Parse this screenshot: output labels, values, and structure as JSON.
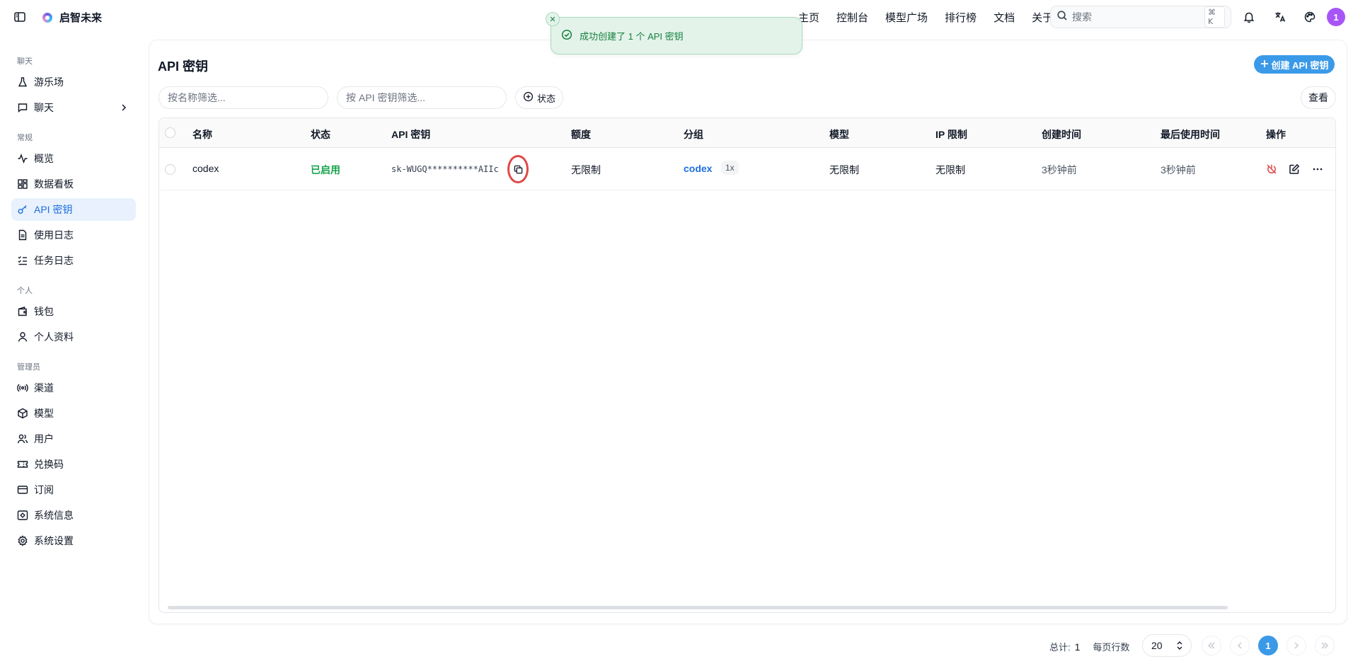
{
  "brand": {
    "name": "启智未来"
  },
  "nav": {
    "items": [
      "主页",
      "控制台",
      "模型广场",
      "排行榜",
      "文档",
      "关于"
    ]
  },
  "search": {
    "placeholder": "搜索",
    "shortcut": "⌘ K"
  },
  "user": {
    "avatar_text": "1",
    "avatar_color": "#a855f7"
  },
  "sidebar": {
    "sections": {
      "chat": "聊天",
      "general": "常规",
      "personal": "个人",
      "admin": "管理员"
    },
    "items": {
      "playground": "游乐场",
      "chat": "聊天",
      "overview": "概览",
      "dashboard": "数据看板",
      "api_keys": "API 密钥",
      "usage_logs": "使用日志",
      "task_logs": "任务日志",
      "wallet": "钱包",
      "profile": "个人资料",
      "channels": "渠道",
      "models": "模型",
      "users": "用户",
      "redeem_codes": "兑换码",
      "subscriptions": "订阅",
      "system_info": "系统信息",
      "system_settings": "系统设置"
    },
    "active": "api_keys"
  },
  "page": {
    "title": "API 密钥",
    "create_button": "创建 API 密钥",
    "filter_name_placeholder": "按名称筛选...",
    "filter_key_placeholder": "按 API 密钥筛选...",
    "status_button": "状态",
    "view_button": "查看"
  },
  "table": {
    "columns": {
      "name": "名称",
      "status": "状态",
      "key": "API 密钥",
      "quota": "额度",
      "group": "分组",
      "model": "模型",
      "ip": "IP 限制",
      "created": "创建时间",
      "last_used": "最后使用时间",
      "actions": "操作"
    },
    "rows": [
      {
        "name": "codex",
        "status": "已启用",
        "key": "sk-WUGQ**********AIIc",
        "quota": "无限制",
        "group": "codex",
        "ratio": "1x",
        "model": "无限制",
        "ip": "无限制",
        "created": "3秒钟前",
        "last_used": "3秒钟前"
      }
    ]
  },
  "pagination": {
    "total_label": "总计:",
    "total": "1",
    "rows_per_page_label": "每页行数",
    "rows_per_page": "20",
    "current_page": "1"
  },
  "toast": {
    "message": "成功创建了 1 个 API 密钥"
  },
  "colors": {
    "accent": "#3b9ae8",
    "active_bg": "#e8f1fd",
    "enabled": "#16a34a",
    "toast_bg": "#e3f3ea",
    "highlight_ring": "#e04848"
  }
}
